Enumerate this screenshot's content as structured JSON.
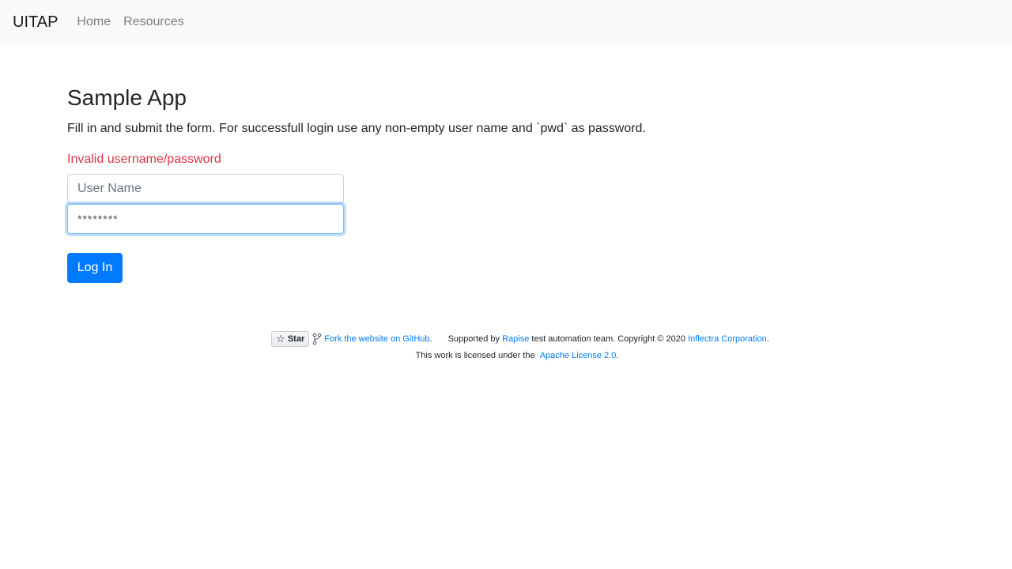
{
  "navbar": {
    "brand": "UITAP",
    "links": [
      "Home",
      "Resources"
    ]
  },
  "main": {
    "title": "Sample App",
    "description": "Fill in and submit the form. For successfull login use any non-empty user name and `pwd` as password.",
    "status_message": "Invalid username/password",
    "username_placeholder": "User Name",
    "username_value": "",
    "password_value": "********",
    "login_label": "Log In"
  },
  "footer": {
    "star_label": "Star",
    "fork_link": "Fork the website on GitHub",
    "supported_prefix": "Supported by ",
    "rapise_link": "Rapise",
    "supported_middle": " test automation team. Copyright © 2020 ",
    "inflectra_link": "Inflectra Corporation",
    "license_prefix": "This work is licensed under the ",
    "license_link": "Apache License 2.0",
    "period": "."
  },
  "colors": {
    "navbar_bg": "#f8f9fa",
    "primary": "#007bff",
    "danger": "#dc3545",
    "link": "#007bff"
  },
  "icons": {
    "star": "star-icon",
    "fork": "fork-icon"
  }
}
